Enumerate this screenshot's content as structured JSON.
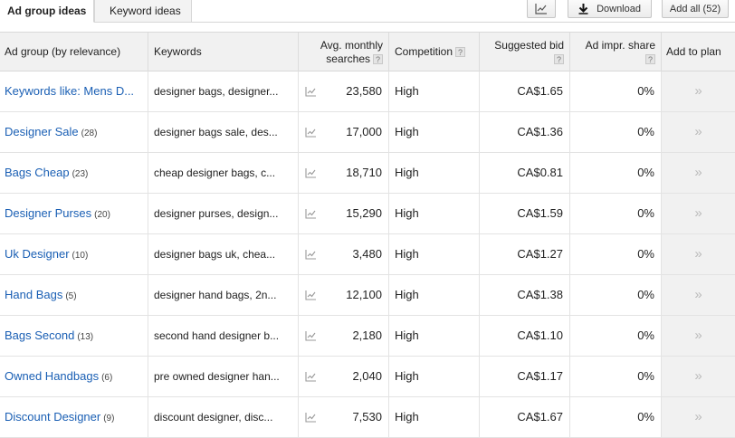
{
  "tabs": [
    {
      "label": "Ad group ideas"
    },
    {
      "label": "Keyword ideas"
    }
  ],
  "toolbar": {
    "download_label": "Download",
    "add_all_label": "Add all (52)"
  },
  "table": {
    "headers": {
      "ad_group": "Ad group (by relevance)",
      "keywords": "Keywords",
      "avg_line1": "Avg. monthly",
      "avg_line2": "searches",
      "competition": "Competition",
      "bid": "Suggested bid",
      "impr": "Ad impr. share",
      "add": "Add to plan",
      "help": "?"
    },
    "rows": [
      {
        "ad_group": "Keywords like: Mens D...",
        "count": "",
        "keywords": "designer bags, designer...",
        "avg": "23,580",
        "competition": "High",
        "bid": "CA$1.65",
        "impr": "0%"
      },
      {
        "ad_group": "Designer Sale",
        "count": "(28)",
        "keywords": "designer bags sale, des...",
        "avg": "17,000",
        "competition": "High",
        "bid": "CA$1.36",
        "impr": "0%"
      },
      {
        "ad_group": "Bags Cheap",
        "count": "(23)",
        "keywords": "cheap designer bags, c...",
        "avg": "18,710",
        "competition": "High",
        "bid": "CA$0.81",
        "impr": "0%"
      },
      {
        "ad_group": "Designer Purses",
        "count": "(20)",
        "keywords": "designer purses, design...",
        "avg": "15,290",
        "competition": "High",
        "bid": "CA$1.59",
        "impr": "0%"
      },
      {
        "ad_group": "Uk Designer",
        "count": "(10)",
        "keywords": "designer bags uk, chea...",
        "avg": "3,480",
        "competition": "High",
        "bid": "CA$1.27",
        "impr": "0%"
      },
      {
        "ad_group": "Hand Bags",
        "count": "(5)",
        "keywords": "designer hand bags, 2n...",
        "avg": "12,100",
        "competition": "High",
        "bid": "CA$1.38",
        "impr": "0%"
      },
      {
        "ad_group": "Bags Second",
        "count": "(13)",
        "keywords": "second hand designer b...",
        "avg": "2,180",
        "competition": "High",
        "bid": "CA$1.10",
        "impr": "0%"
      },
      {
        "ad_group": "Owned Handbags",
        "count": "(6)",
        "keywords": "pre owned designer han...",
        "avg": "2,040",
        "competition": "High",
        "bid": "CA$1.17",
        "impr": "0%"
      },
      {
        "ad_group": "Discount Designer",
        "count": "(9)",
        "keywords": "discount designer, disc...",
        "avg": "7,530",
        "competition": "High",
        "bid": "CA$1.67",
        "impr": "0%"
      }
    ]
  },
  "icons": {
    "trend": "trend-chart-icon",
    "add": "double-chevron-right-icon",
    "download": "download-icon",
    "chart": "chart-icon"
  }
}
